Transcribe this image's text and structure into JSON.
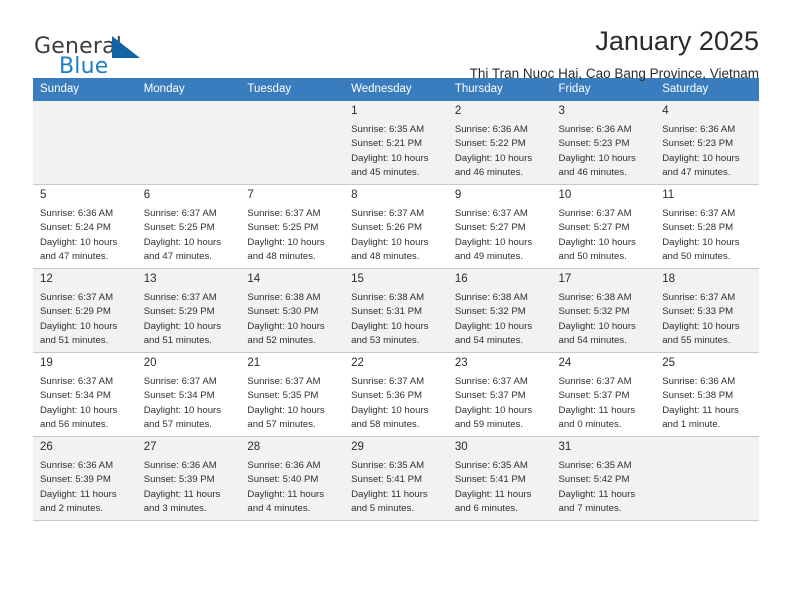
{
  "brand": {
    "name_part1": "General",
    "name_part2": "Blue",
    "triangle_color": "#1464a5",
    "blue_text_color": "#1f7fc4"
  },
  "header": {
    "title": "January 2025",
    "subtitle": "Thi Tran Nuoc Hai, Cao Bang Province, Vietnam"
  },
  "theme": {
    "header_bar_color": "#3a7dbf",
    "header_text_color": "#ffffff",
    "alt_row_color": "#f2f2f2",
    "grid_line_color": "#c9c9c9"
  },
  "weekday_headers": [
    "Sunday",
    "Monday",
    "Tuesday",
    "Wednesday",
    "Thursday",
    "Friday",
    "Saturday"
  ],
  "labels": {
    "sunrise_prefix": "Sunrise:",
    "sunset_prefix": "Sunset:",
    "daylight_prefix": "Daylight:"
  },
  "weeks": [
    {
      "shaded": true,
      "days": [
        {
          "day": "",
          "detail": ""
        },
        {
          "day": "",
          "detail": ""
        },
        {
          "day": "",
          "detail": ""
        },
        {
          "day": "1",
          "detail": "Sunrise: 6:35 AM\nSunset: 5:21 PM\nDaylight: 10 hours\nand 45 minutes."
        },
        {
          "day": "2",
          "detail": "Sunrise: 6:36 AM\nSunset: 5:22 PM\nDaylight: 10 hours\nand 46 minutes."
        },
        {
          "day": "3",
          "detail": "Sunrise: 6:36 AM\nSunset: 5:23 PM\nDaylight: 10 hours\nand 46 minutes."
        },
        {
          "day": "4",
          "detail": "Sunrise: 6:36 AM\nSunset: 5:23 PM\nDaylight: 10 hours\nand 47 minutes."
        }
      ]
    },
    {
      "shaded": false,
      "days": [
        {
          "day": "5",
          "detail": "Sunrise: 6:36 AM\nSunset: 5:24 PM\nDaylight: 10 hours\nand 47 minutes."
        },
        {
          "day": "6",
          "detail": "Sunrise: 6:37 AM\nSunset: 5:25 PM\nDaylight: 10 hours\nand 47 minutes."
        },
        {
          "day": "7",
          "detail": "Sunrise: 6:37 AM\nSunset: 5:25 PM\nDaylight: 10 hours\nand 48 minutes."
        },
        {
          "day": "8",
          "detail": "Sunrise: 6:37 AM\nSunset: 5:26 PM\nDaylight: 10 hours\nand 48 minutes."
        },
        {
          "day": "9",
          "detail": "Sunrise: 6:37 AM\nSunset: 5:27 PM\nDaylight: 10 hours\nand 49 minutes."
        },
        {
          "day": "10",
          "detail": "Sunrise: 6:37 AM\nSunset: 5:27 PM\nDaylight: 10 hours\nand 50 minutes."
        },
        {
          "day": "11",
          "detail": "Sunrise: 6:37 AM\nSunset: 5:28 PM\nDaylight: 10 hours\nand 50 minutes."
        }
      ]
    },
    {
      "shaded": true,
      "days": [
        {
          "day": "12",
          "detail": "Sunrise: 6:37 AM\nSunset: 5:29 PM\nDaylight: 10 hours\nand 51 minutes."
        },
        {
          "day": "13",
          "detail": "Sunrise: 6:37 AM\nSunset: 5:29 PM\nDaylight: 10 hours\nand 51 minutes."
        },
        {
          "day": "14",
          "detail": "Sunrise: 6:38 AM\nSunset: 5:30 PM\nDaylight: 10 hours\nand 52 minutes."
        },
        {
          "day": "15",
          "detail": "Sunrise: 6:38 AM\nSunset: 5:31 PM\nDaylight: 10 hours\nand 53 minutes."
        },
        {
          "day": "16",
          "detail": "Sunrise: 6:38 AM\nSunset: 5:32 PM\nDaylight: 10 hours\nand 54 minutes."
        },
        {
          "day": "17",
          "detail": "Sunrise: 6:38 AM\nSunset: 5:32 PM\nDaylight: 10 hours\nand 54 minutes."
        },
        {
          "day": "18",
          "detail": "Sunrise: 6:37 AM\nSunset: 5:33 PM\nDaylight: 10 hours\nand 55 minutes."
        }
      ]
    },
    {
      "shaded": false,
      "days": [
        {
          "day": "19",
          "detail": "Sunrise: 6:37 AM\nSunset: 5:34 PM\nDaylight: 10 hours\nand 56 minutes."
        },
        {
          "day": "20",
          "detail": "Sunrise: 6:37 AM\nSunset: 5:34 PM\nDaylight: 10 hours\nand 57 minutes."
        },
        {
          "day": "21",
          "detail": "Sunrise: 6:37 AM\nSunset: 5:35 PM\nDaylight: 10 hours\nand 57 minutes."
        },
        {
          "day": "22",
          "detail": "Sunrise: 6:37 AM\nSunset: 5:36 PM\nDaylight: 10 hours\nand 58 minutes."
        },
        {
          "day": "23",
          "detail": "Sunrise: 6:37 AM\nSunset: 5:37 PM\nDaylight: 10 hours\nand 59 minutes."
        },
        {
          "day": "24",
          "detail": "Sunrise: 6:37 AM\nSunset: 5:37 PM\nDaylight: 11 hours\nand 0 minutes."
        },
        {
          "day": "25",
          "detail": "Sunrise: 6:36 AM\nSunset: 5:38 PM\nDaylight: 11 hours\nand 1 minute."
        }
      ]
    },
    {
      "shaded": true,
      "days": [
        {
          "day": "26",
          "detail": "Sunrise: 6:36 AM\nSunset: 5:39 PM\nDaylight: 11 hours\nand 2 minutes."
        },
        {
          "day": "27",
          "detail": "Sunrise: 6:36 AM\nSunset: 5:39 PM\nDaylight: 11 hours\nand 3 minutes."
        },
        {
          "day": "28",
          "detail": "Sunrise: 6:36 AM\nSunset: 5:40 PM\nDaylight: 11 hours\nand 4 minutes."
        },
        {
          "day": "29",
          "detail": "Sunrise: 6:35 AM\nSunset: 5:41 PM\nDaylight: 11 hours\nand 5 minutes."
        },
        {
          "day": "30",
          "detail": "Sunrise: 6:35 AM\nSunset: 5:41 PM\nDaylight: 11 hours\nand 6 minutes."
        },
        {
          "day": "31",
          "detail": "Sunrise: 6:35 AM\nSunset: 5:42 PM\nDaylight: 11 hours\nand 7 minutes."
        },
        {
          "day": "",
          "detail": ""
        }
      ]
    }
  ]
}
